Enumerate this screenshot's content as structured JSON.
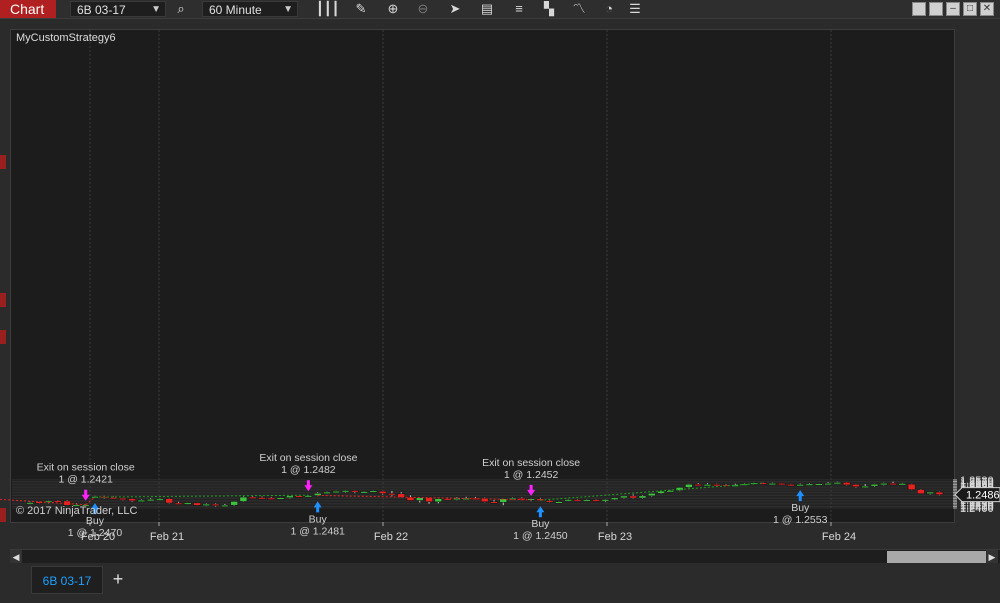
{
  "toolbar": {
    "chart_label": "Chart",
    "instrument": "6B 03-17",
    "interval": "60 Minute",
    "icons": [
      "search-icon",
      "bar-type-icon",
      "pencil-icon",
      "zoom-in-icon",
      "zoom-out-icon",
      "pointer-icon",
      "data-box-icon",
      "indicators-icon",
      "strategies-icon",
      "drawing-tools-icon",
      "refresh-icon",
      "properties-icon"
    ],
    "window_buttons": [
      "tile-icon",
      "tile2-icon",
      "minimize-icon",
      "maximize-icon",
      "close-icon"
    ]
  },
  "chart": {
    "strategy_name": "MyCustomStrategy6",
    "copyright": "© 2017 NinjaTrader, LLC",
    "current_price": "1.2486",
    "y_ticks": [
      "1.2580",
      "1.2570",
      "1.2560",
      "1.2550",
      "1.2540",
      "1.2530",
      "1.2520",
      "1.2510",
      "1.2500",
      "1.2490",
      "1.2480",
      "1.2470",
      "1.2460",
      "1.2450",
      "1.2440",
      "1.2430",
      "1.2420",
      "1.2410",
      "1.2400"
    ],
    "x_labels": [
      "Feb 20",
      "Feb 21",
      "Feb 22",
      "Feb 23",
      "Feb 24"
    ],
    "trades": [
      {
        "entry_label": "Buy",
        "entry_text": "1 @ 1.2470",
        "exit_label": "Exit on session close",
        "exit_text": "1 @ 1.2421",
        "result": "loss"
      },
      {
        "entry_label": "Buy",
        "entry_text": "1 @ 1.2481",
        "exit_label": "Exit on session close",
        "exit_text": "1 @ 1.2482",
        "result": "win"
      },
      {
        "entry_label": "Buy",
        "entry_text": "1 @ 1.2450",
        "exit_label": "Exit on session close",
        "exit_text": "1 @ 1.2452",
        "result": "win"
      },
      {
        "entry_label": "Buy",
        "entry_text": "1 @ 1.2553",
        "exit_label": "",
        "exit_text": "",
        "result": "open"
      }
    ],
    "colors": {
      "up": "#3ec23e",
      "down": "#e8231f",
      "buy_arrow": "#1e90ff",
      "exit_arrow": "#ff22ff",
      "win_line": "#1f9e1f",
      "loss_line": "#e8231f",
      "background": "#1c1c1c"
    }
  },
  "chart_data": {
    "type": "candlestick",
    "instrument": "6B 03-17",
    "interval": "60 Minute",
    "ylim": [
      1.2395,
      1.2585
    ],
    "candles": [
      {
        "o": 1.2429,
        "h": 1.244,
        "l": 1.2423,
        "c": 1.2435
      },
      {
        "o": 1.244,
        "h": 1.2443,
        "l": 1.2427,
        "c": 1.2432
      },
      {
        "o": 1.2436,
        "h": 1.2448,
        "l": 1.243,
        "c": 1.2445
      },
      {
        "o": 1.2446,
        "h": 1.245,
        "l": 1.244,
        "c": 1.2445
      },
      {
        "o": 1.2445,
        "h": 1.245,
        "l": 1.2415,
        "c": 1.2417
      },
      {
        "o": 1.2417,
        "h": 1.243,
        "l": 1.2414,
        "c": 1.242
      },
      {
        "o": 1.2418,
        "h": 1.2425,
        "l": 1.2413,
        "c": 1.2422
      },
      {
        "o": 1.2467,
        "h": 1.2478,
        "l": 1.2465,
        "c": 1.2474
      },
      {
        "o": 1.2474,
        "h": 1.2478,
        "l": 1.246,
        "c": 1.2468
      },
      {
        "o": 1.2468,
        "h": 1.2473,
        "l": 1.2458,
        "c": 1.2463
      },
      {
        "o": 1.2463,
        "h": 1.2465,
        "l": 1.245,
        "c": 1.246
      },
      {
        "o": 1.246,
        "h": 1.2462,
        "l": 1.244,
        "c": 1.2446
      },
      {
        "o": 1.2446,
        "h": 1.2455,
        "l": 1.2443,
        "c": 1.245
      },
      {
        "o": 1.245,
        "h": 1.2462,
        "l": 1.2448,
        "c": 1.2455
      },
      {
        "o": 1.2455,
        "h": 1.2462,
        "l": 1.2451,
        "c": 1.2458
      },
      {
        "o": 1.246,
        "h": 1.2463,
        "l": 1.2428,
        "c": 1.2432
      },
      {
        "o": 1.2432,
        "h": 1.244,
        "l": 1.2426,
        "c": 1.243
      },
      {
        "o": 1.243,
        "h": 1.2435,
        "l": 1.2422,
        "c": 1.2433
      },
      {
        "o": 1.2433,
        "h": 1.2435,
        "l": 1.2415,
        "c": 1.2417
      },
      {
        "o": 1.2417,
        "h": 1.243,
        "l": 1.2412,
        "c": 1.2425
      },
      {
        "o": 1.2425,
        "h": 1.243,
        "l": 1.241,
        "c": 1.2416
      },
      {
        "o": 1.2416,
        "h": 1.2426,
        "l": 1.2409,
        "c": 1.2418
      },
      {
        "o": 1.2418,
        "h": 1.2445,
        "l": 1.2413,
        "c": 1.2442
      },
      {
        "o": 1.2442,
        "h": 1.2475,
        "l": 1.2438,
        "c": 1.247
      },
      {
        "o": 1.247,
        "h": 1.2476,
        "l": 1.2462,
        "c": 1.2467
      },
      {
        "o": 1.2467,
        "h": 1.2474,
        "l": 1.2462,
        "c": 1.2464
      },
      {
        "o": 1.2464,
        "h": 1.247,
        "l": 1.2458,
        "c": 1.2461
      },
      {
        "o": 1.2461,
        "h": 1.2468,
        "l": 1.2457,
        "c": 1.2466
      },
      {
        "o": 1.2466,
        "h": 1.248,
        "l": 1.2462,
        "c": 1.2478
      },
      {
        "o": 1.2478,
        "h": 1.2481,
        "l": 1.247,
        "c": 1.2476
      },
      {
        "o": 1.2476,
        "h": 1.2483,
        "l": 1.2471,
        "c": 1.248
      },
      {
        "o": 1.248,
        "h": 1.25,
        "l": 1.2476,
        "c": 1.2494
      },
      {
        "o": 1.2494,
        "h": 1.2505,
        "l": 1.249,
        "c": 1.2502
      },
      {
        "o": 1.2502,
        "h": 1.251,
        "l": 1.25,
        "c": 1.2507
      },
      {
        "o": 1.2507,
        "h": 1.2514,
        "l": 1.2498,
        "c": 1.2512
      },
      {
        "o": 1.2512,
        "h": 1.2514,
        "l": 1.2495,
        "c": 1.2503
      },
      {
        "o": 1.2503,
        "h": 1.2508,
        "l": 1.2498,
        "c": 1.2505
      },
      {
        "o": 1.2505,
        "h": 1.2513,
        "l": 1.2499,
        "c": 1.251
      },
      {
        "o": 1.2507,
        "h": 1.251,
        "l": 1.2487,
        "c": 1.2493
      },
      {
        "o": 1.2493,
        "h": 1.2509,
        "l": 1.2475,
        "c": 1.2492
      },
      {
        "o": 1.2491,
        "h": 1.2502,
        "l": 1.2466,
        "c": 1.2468
      },
      {
        "o": 1.2468,
        "h": 1.2481,
        "l": 1.2449,
        "c": 1.2448
      },
      {
        "o": 1.2448,
        "h": 1.2469,
        "l": 1.2435,
        "c": 1.2466
      },
      {
        "o": 1.2466,
        "h": 1.2468,
        "l": 1.2427,
        "c": 1.244
      },
      {
        "o": 1.244,
        "h": 1.2463,
        "l": 1.243,
        "c": 1.246
      },
      {
        "o": 1.246,
        "h": 1.2466,
        "l": 1.2452,
        "c": 1.2455
      },
      {
        "o": 1.2455,
        "h": 1.2468,
        "l": 1.245,
        "c": 1.2462
      },
      {
        "o": 1.2462,
        "h": 1.2472,
        "l": 1.2455,
        "c": 1.2463
      },
      {
        "o": 1.2463,
        "h": 1.2471,
        "l": 1.2457,
        "c": 1.2461
      },
      {
        "o": 1.2461,
        "h": 1.2466,
        "l": 1.2437,
        "c": 1.244
      },
      {
        "o": 1.244,
        "h": 1.2451,
        "l": 1.2429,
        "c": 1.2436
      },
      {
        "o": 1.2436,
        "h": 1.2462,
        "l": 1.2418,
        "c": 1.246
      },
      {
        "o": 1.246,
        "h": 1.2467,
        "l": 1.2455,
        "c": 1.2463
      },
      {
        "o": 1.2463,
        "h": 1.2468,
        "l": 1.245,
        "c": 1.2452
      },
      {
        "o": 1.2452,
        "h": 1.2462,
        "l": 1.2444,
        "c": 1.2459
      },
      {
        "o": 1.2459,
        "h": 1.2465,
        "l": 1.2447,
        "c": 1.2447
      },
      {
        "o": 1.2447,
        "h": 1.2451,
        "l": 1.2434,
        "c": 1.2438
      },
      {
        "o": 1.2438,
        "h": 1.2443,
        "l": 1.2435,
        "c": 1.244
      },
      {
        "o": 1.2445,
        "h": 1.2457,
        "l": 1.2443,
        "c": 1.2454
      },
      {
        "o": 1.2454,
        "h": 1.2458,
        "l": 1.2444,
        "c": 1.2447
      },
      {
        "o": 1.2447,
        "h": 1.2456,
        "l": 1.2442,
        "c": 1.2452
      },
      {
        "o": 1.2452,
        "h": 1.2456,
        "l": 1.2446,
        "c": 1.2445
      },
      {
        "o": 1.2445,
        "h": 1.2457,
        "l": 1.2438,
        "c": 1.2454
      },
      {
        "o": 1.2454,
        "h": 1.2467,
        "l": 1.2451,
        "c": 1.2465
      },
      {
        "o": 1.2465,
        "h": 1.2479,
        "l": 1.2461,
        "c": 1.2477
      },
      {
        "o": 1.2477,
        "h": 1.2487,
        "l": 1.246,
        "c": 1.2464
      },
      {
        "o": 1.2464,
        "h": 1.2483,
        "l": 1.246,
        "c": 1.2478
      },
      {
        "o": 1.2478,
        "h": 1.2497,
        "l": 1.2474,
        "c": 1.2494
      },
      {
        "o": 1.2494,
        "h": 1.251,
        "l": 1.249,
        "c": 1.2508
      },
      {
        "o": 1.2508,
        "h": 1.2516,
        "l": 1.2504,
        "c": 1.2512
      },
      {
        "o": 1.2512,
        "h": 1.2533,
        "l": 1.2508,
        "c": 1.2532
      },
      {
        "o": 1.2532,
        "h": 1.2555,
        "l": 1.2528,
        "c": 1.2552
      },
      {
        "o": 1.2552,
        "h": 1.2559,
        "l": 1.2546,
        "c": 1.2551
      },
      {
        "o": 1.2548,
        "h": 1.2559,
        "l": 1.2543,
        "c": 1.2551
      },
      {
        "o": 1.2551,
        "h": 1.2555,
        "l": 1.2544,
        "c": 1.2549
      },
      {
        "o": 1.2548,
        "h": 1.2553,
        "l": 1.2541,
        "c": 1.2546
      },
      {
        "o": 1.2546,
        "h": 1.2556,
        "l": 1.254,
        "c": 1.2547
      },
      {
        "o": 1.2547,
        "h": 1.2558,
        "l": 1.2544,
        "c": 1.2554
      },
      {
        "o": 1.2553,
        "h": 1.2564,
        "l": 1.255,
        "c": 1.2561
      },
      {
        "o": 1.2561,
        "h": 1.2565,
        "l": 1.2552,
        "c": 1.2555
      },
      {
        "o": 1.2556,
        "h": 1.2562,
        "l": 1.255,
        "c": 1.2558
      },
      {
        "o": 1.2558,
        "h": 1.256,
        "l": 1.2547,
        "c": 1.2551
      },
      {
        "o": 1.2551,
        "h": 1.2554,
        "l": 1.2543,
        "c": 1.2547
      },
      {
        "o": 1.2547,
        "h": 1.2556,
        "l": 1.2541,
        "c": 1.2551
      },
      {
        "o": 1.2551,
        "h": 1.2559,
        "l": 1.2547,
        "c": 1.2554
      },
      {
        "o": 1.2554,
        "h": 1.2557,
        "l": 1.255,
        "c": 1.2555
      },
      {
        "o": 1.2555,
        "h": 1.2565,
        "l": 1.2549,
        "c": 1.2558
      },
      {
        "o": 1.2556,
        "h": 1.2568,
        "l": 1.2553,
        "c": 1.2564
      },
      {
        "o": 1.2564,
        "h": 1.2566,
        "l": 1.2545,
        "c": 1.2548
      },
      {
        "o": 1.2551,
        "h": 1.2554,
        "l": 1.2532,
        "c": 1.2537
      },
      {
        "o": 1.2537,
        "h": 1.2553,
        "l": 1.253,
        "c": 1.254
      },
      {
        "o": 1.254,
        "h": 1.2555,
        "l": 1.2535,
        "c": 1.2552
      },
      {
        "o": 1.2552,
        "h": 1.2562,
        "l": 1.2545,
        "c": 1.2558
      },
      {
        "o": 1.2558,
        "h": 1.2569,
        "l": 1.2548,
        "c": 1.2555
      },
      {
        "o": 1.2555,
        "h": 1.2561,
        "l": 1.255,
        "c": 1.2557
      },
      {
        "o": 1.2553,
        "h": 1.2555,
        "l": 1.2515,
        "c": 1.2518
      },
      {
        "o": 1.2518,
        "h": 1.2522,
        "l": 1.2491,
        "c": 1.2492
      },
      {
        "o": 1.2492,
        "h": 1.2503,
        "l": 1.2487,
        "c": 1.2502
      },
      {
        "o": 1.2502,
        "h": 1.2505,
        "l": 1.2482,
        "c": 1.2486
      }
    ],
    "session_separators": [
      "Feb 20",
      "Feb 21",
      "Feb 22",
      "Feb 23",
      "Feb 24"
    ],
    "trades": [
      {
        "entry": 1.247,
        "exit": 1.2421,
        "result": "loss"
      },
      {
        "entry": 1.2481,
        "exit": 1.2482,
        "result": "win"
      },
      {
        "entry": 1.245,
        "exit": 1.2452,
        "result": "win"
      },
      {
        "entry": 1.2553,
        "exit": null,
        "result": "open"
      }
    ]
  },
  "tabs": {
    "active": "6B 03-17",
    "add_label": "+"
  }
}
